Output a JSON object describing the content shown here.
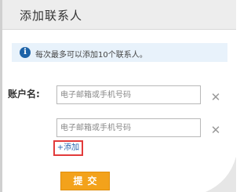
{
  "dialog": {
    "title": "添加联系人"
  },
  "info": {
    "icon": "info-icon",
    "icon_glyph": "i",
    "message": "每次最多可以添加10个联系人。"
  },
  "form": {
    "label": "账户名:",
    "inputs": [
      {
        "value": "",
        "placeholder": "电子邮箱或手机号码"
      },
      {
        "value": "",
        "placeholder": "电子邮箱或手机号码"
      }
    ],
    "remove_glyph": "✕",
    "add_label": "+添加",
    "submit_label": "提交"
  },
  "colors": {
    "accent": "#f3a21b",
    "info_bg": "#e8f2fb",
    "link": "#2a65b0",
    "highlight": "#e23b3b"
  }
}
